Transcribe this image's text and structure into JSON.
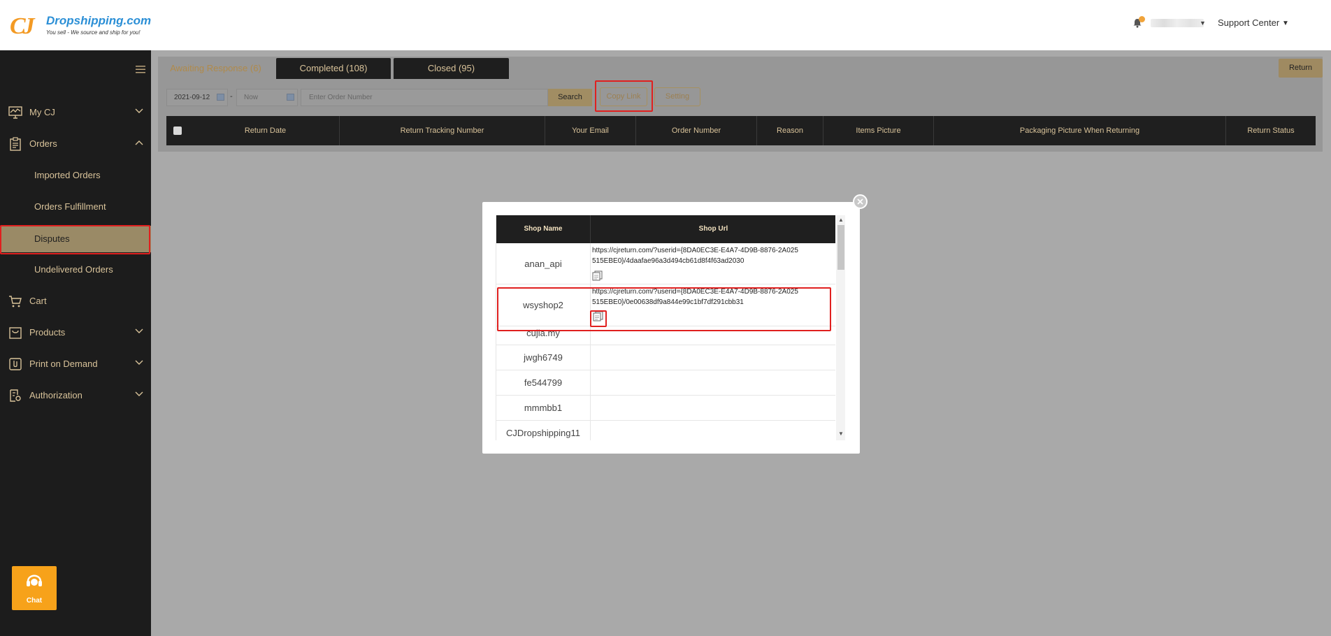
{
  "header": {
    "logo_mark": "CJ",
    "brand": "Dropshipping.com",
    "tagline": "You sell - We source and ship for you!",
    "support_center": "Support Center"
  },
  "sidebar": {
    "items": [
      {
        "label": "My CJ",
        "icon": "monitor-chart-icon"
      },
      {
        "label": "Orders",
        "icon": "clipboard-icon"
      },
      {
        "label": "Imported Orders"
      },
      {
        "label": "Orders Fulfillment"
      },
      {
        "label": "Disputes"
      },
      {
        "label": "Undelivered Orders"
      },
      {
        "label": "Cart",
        "icon": "cart-icon"
      },
      {
        "label": "Products",
        "icon": "bag-icon"
      },
      {
        "label": "Print on Demand",
        "icon": "paperclip-icon"
      },
      {
        "label": "Authorization",
        "icon": "document-gear-icon"
      }
    ],
    "active": "Disputes",
    "chat_label": "Chat"
  },
  "tabs": [
    {
      "label": "Awaiting Response (6)"
    },
    {
      "label": "Completed (108)"
    },
    {
      "label": "Closed (95)"
    }
  ],
  "return_button": "Return",
  "filters": {
    "start_date": "2021-09-12",
    "separator": "-",
    "end_date_placeholder": "Now",
    "order_placeholder": "Enter Order Number",
    "search_label": "Search",
    "copy_link_label": "Copy Link",
    "setting_label": "Setting"
  },
  "table": {
    "columns": [
      "Return Date",
      "Return Tracking Number",
      "Your Email",
      "Order Number",
      "Reason",
      "Items Picture",
      "Packaging Picture When Returning",
      "Return Status"
    ]
  },
  "modal": {
    "columns": [
      "Shop Name",
      "Shop Url"
    ],
    "rows": [
      {
        "shop": "anan_api",
        "url": "https://cjreturn.com/?userid={8DA0EC3E-E4A7-4D9B-8876-2A025515EBE0}/4daafae96a3d494cb61d8f4f63ad2030"
      },
      {
        "shop": "wsyshop2",
        "url": "https://cjreturn.com/?userid={8DA0EC3E-E4A7-4D9B-8876-2A025515EBE0}/0e00638df9a844e99c1bf7df291cbb31"
      },
      {
        "shop": "cujia.my",
        "url": ""
      },
      {
        "shop": "jwgh6749",
        "url": ""
      },
      {
        "shop": "fe544799",
        "url": ""
      },
      {
        "shop": "mmmbb1",
        "url": ""
      },
      {
        "shop": "CJDropshipping11",
        "url": ""
      }
    ]
  },
  "colors": {
    "sidebar_bg": "#1c1c1c",
    "gold": "#d9c39a",
    "highlight_red": "#e0201f",
    "chat_orange": "#f7a21a"
  }
}
